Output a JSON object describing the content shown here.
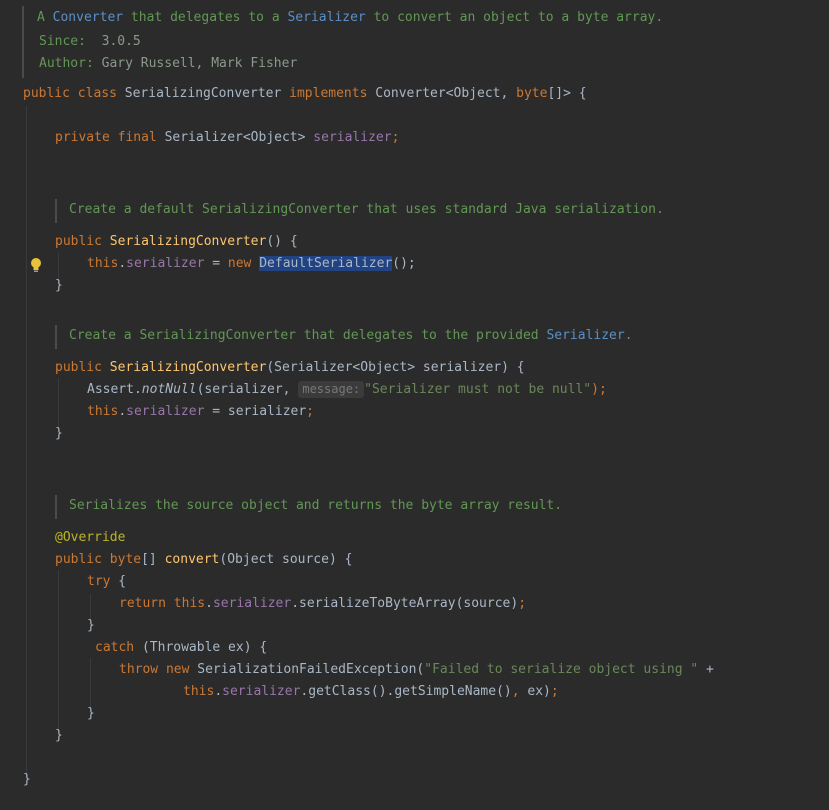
{
  "class_doc": {
    "l1_a": "A ",
    "l1_link1": "Converter",
    "l1_b": " that delegates to a ",
    "l1_link2": "Serializer",
    "l1_c": " to convert an object to a byte array.",
    "since_label": "Since:",
    "since_value": "3.0.5",
    "author_label": "Author:",
    "author_value": "Gary Russell, Mark Fisher"
  },
  "class_decl": {
    "public": "public",
    "class_kw": "class",
    "name": "SerializingConverter",
    "implements": "implements",
    "iface": "Converter<Object, ",
    "byte_kw": "byte",
    "tail": "[]> {"
  },
  "field_decl": {
    "mods": "private final",
    "type": "Serializer<Object>",
    "name": "serializer",
    "semi": ";"
  },
  "ctor1_doc": "Create a default SerializingConverter that uses standard Java serialization.",
  "ctor1": {
    "public": "public",
    "name": "SerializingConverter",
    "params": "() {",
    "this_kw": "this",
    "dot": ".",
    "field": "serializer",
    "eq": " = ",
    "new_kw": "new",
    "type": "DefaultSerializer",
    "tail": "();",
    "close": "}"
  },
  "ctor2_doc": {
    "a": "Create a SerializingConverter that delegates to the provided ",
    "link": "Serializer",
    "b": "."
  },
  "ctor2": {
    "public": "public",
    "name": "SerializingConverter",
    "params": "(Serializer<Object> serializer) {",
    "assert_obj": "Assert.",
    "assert_fn": "notNull",
    "assert_arg": "(serializer,",
    "hint": "message:",
    "msg": "\"Serializer must not be null\"",
    "assert_tail": ");",
    "this_kw": "this",
    "dot": ".",
    "field": "serializer",
    "assign": " = serializer",
    "semi": ";",
    "close": "}"
  },
  "convert_doc": "Serializes the source object and returns the byte array result.",
  "convert": {
    "annotation": "@Override",
    "public": "public",
    "byte_kw": "byte",
    "brackets": "[] ",
    "name": "convert",
    "params": "(Object source) {",
    "try_kw": "try",
    "try_brace": " {",
    "return_kw": "return",
    "this_kw": "this",
    "dot": ".",
    "field": "serializer",
    "call": ".serializeToByteArray(source)",
    "semi": ";",
    "close_try": "}",
    "catch_kw": "catch",
    "catch_params": " (Throwable ex) {",
    "throw_kw": "throw",
    "new_kw": "new",
    "exc": "SerializationFailedException(",
    "msg": "\"Failed to serialize object using \"",
    "plus": " +",
    "this2": "this",
    "dot2": ".",
    "field2": "serializer",
    "call2": ".getClass().getSimpleName()",
    "comma": ",",
    "tail2": " ex)",
    "semi2": ";",
    "close_catch": "}",
    "close_method": "}"
  },
  "class_close": "}"
}
